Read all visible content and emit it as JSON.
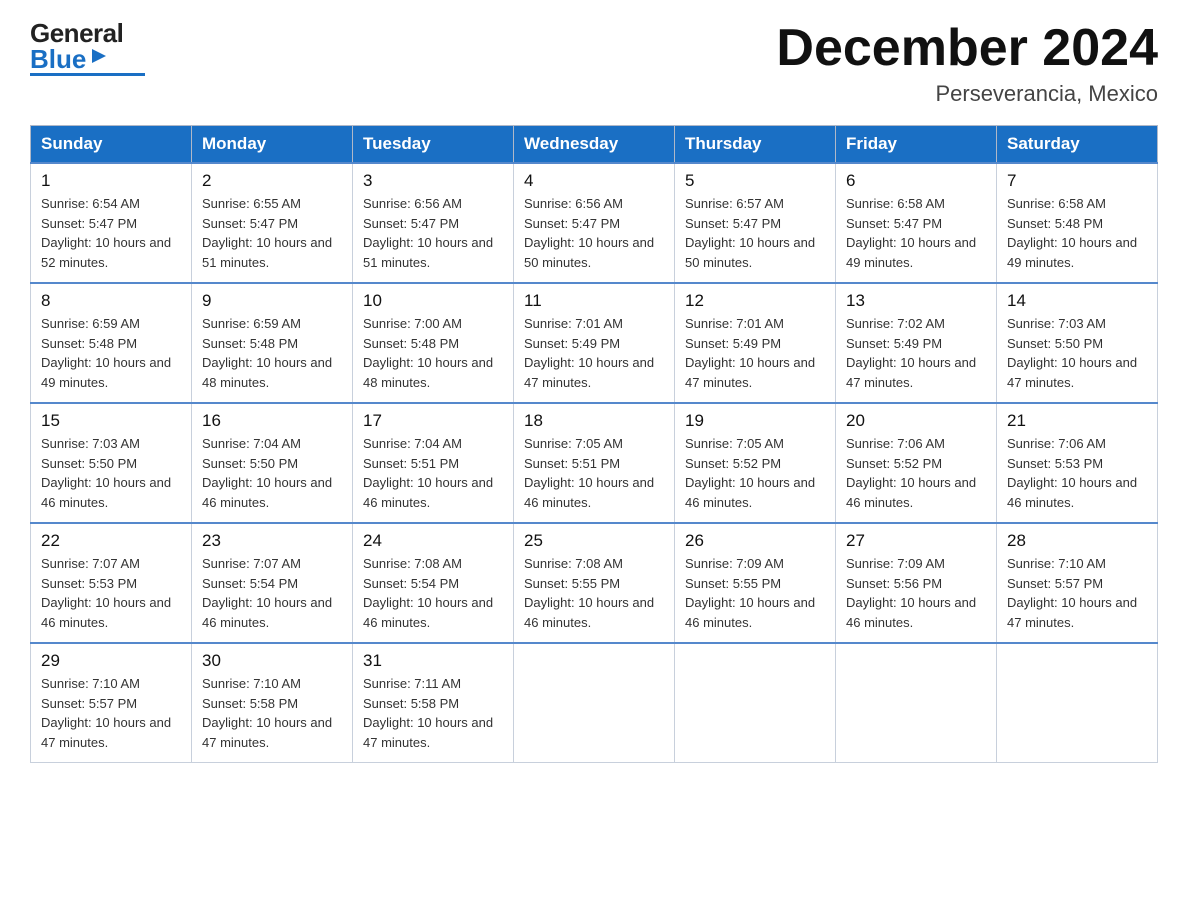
{
  "header": {
    "logo_general": "General",
    "logo_blue": "Blue",
    "month_title": "December 2024",
    "subtitle": "Perseverancia, Mexico"
  },
  "days_of_week": [
    "Sunday",
    "Monday",
    "Tuesday",
    "Wednesday",
    "Thursday",
    "Friday",
    "Saturday"
  ],
  "weeks": [
    [
      {
        "day": "1",
        "sunrise": "6:54 AM",
        "sunset": "5:47 PM",
        "daylight": "10 hours and 52 minutes."
      },
      {
        "day": "2",
        "sunrise": "6:55 AM",
        "sunset": "5:47 PM",
        "daylight": "10 hours and 51 minutes."
      },
      {
        "day": "3",
        "sunrise": "6:56 AM",
        "sunset": "5:47 PM",
        "daylight": "10 hours and 51 minutes."
      },
      {
        "day": "4",
        "sunrise": "6:56 AM",
        "sunset": "5:47 PM",
        "daylight": "10 hours and 50 minutes."
      },
      {
        "day": "5",
        "sunrise": "6:57 AM",
        "sunset": "5:47 PM",
        "daylight": "10 hours and 50 minutes."
      },
      {
        "day": "6",
        "sunrise": "6:58 AM",
        "sunset": "5:47 PM",
        "daylight": "10 hours and 49 minutes."
      },
      {
        "day": "7",
        "sunrise": "6:58 AM",
        "sunset": "5:48 PM",
        "daylight": "10 hours and 49 minutes."
      }
    ],
    [
      {
        "day": "8",
        "sunrise": "6:59 AM",
        "sunset": "5:48 PM",
        "daylight": "10 hours and 49 minutes."
      },
      {
        "day": "9",
        "sunrise": "6:59 AM",
        "sunset": "5:48 PM",
        "daylight": "10 hours and 48 minutes."
      },
      {
        "day": "10",
        "sunrise": "7:00 AM",
        "sunset": "5:48 PM",
        "daylight": "10 hours and 48 minutes."
      },
      {
        "day": "11",
        "sunrise": "7:01 AM",
        "sunset": "5:49 PM",
        "daylight": "10 hours and 47 minutes."
      },
      {
        "day": "12",
        "sunrise": "7:01 AM",
        "sunset": "5:49 PM",
        "daylight": "10 hours and 47 minutes."
      },
      {
        "day": "13",
        "sunrise": "7:02 AM",
        "sunset": "5:49 PM",
        "daylight": "10 hours and 47 minutes."
      },
      {
        "day": "14",
        "sunrise": "7:03 AM",
        "sunset": "5:50 PM",
        "daylight": "10 hours and 47 minutes."
      }
    ],
    [
      {
        "day": "15",
        "sunrise": "7:03 AM",
        "sunset": "5:50 PM",
        "daylight": "10 hours and 46 minutes."
      },
      {
        "day": "16",
        "sunrise": "7:04 AM",
        "sunset": "5:50 PM",
        "daylight": "10 hours and 46 minutes."
      },
      {
        "day": "17",
        "sunrise": "7:04 AM",
        "sunset": "5:51 PM",
        "daylight": "10 hours and 46 minutes."
      },
      {
        "day": "18",
        "sunrise": "7:05 AM",
        "sunset": "5:51 PM",
        "daylight": "10 hours and 46 minutes."
      },
      {
        "day": "19",
        "sunrise": "7:05 AM",
        "sunset": "5:52 PM",
        "daylight": "10 hours and 46 minutes."
      },
      {
        "day": "20",
        "sunrise": "7:06 AM",
        "sunset": "5:52 PM",
        "daylight": "10 hours and 46 minutes."
      },
      {
        "day": "21",
        "sunrise": "7:06 AM",
        "sunset": "5:53 PM",
        "daylight": "10 hours and 46 minutes."
      }
    ],
    [
      {
        "day": "22",
        "sunrise": "7:07 AM",
        "sunset": "5:53 PM",
        "daylight": "10 hours and 46 minutes."
      },
      {
        "day": "23",
        "sunrise": "7:07 AM",
        "sunset": "5:54 PM",
        "daylight": "10 hours and 46 minutes."
      },
      {
        "day": "24",
        "sunrise": "7:08 AM",
        "sunset": "5:54 PM",
        "daylight": "10 hours and 46 minutes."
      },
      {
        "day": "25",
        "sunrise": "7:08 AM",
        "sunset": "5:55 PM",
        "daylight": "10 hours and 46 minutes."
      },
      {
        "day": "26",
        "sunrise": "7:09 AM",
        "sunset": "5:55 PM",
        "daylight": "10 hours and 46 minutes."
      },
      {
        "day": "27",
        "sunrise": "7:09 AM",
        "sunset": "5:56 PM",
        "daylight": "10 hours and 46 minutes."
      },
      {
        "day": "28",
        "sunrise": "7:10 AM",
        "sunset": "5:57 PM",
        "daylight": "10 hours and 47 minutes."
      }
    ],
    [
      {
        "day": "29",
        "sunrise": "7:10 AM",
        "sunset": "5:57 PM",
        "daylight": "10 hours and 47 minutes."
      },
      {
        "day": "30",
        "sunrise": "7:10 AM",
        "sunset": "5:58 PM",
        "daylight": "10 hours and 47 minutes."
      },
      {
        "day": "31",
        "sunrise": "7:11 AM",
        "sunset": "5:58 PM",
        "daylight": "10 hours and 47 minutes."
      },
      null,
      null,
      null,
      null
    ]
  ]
}
